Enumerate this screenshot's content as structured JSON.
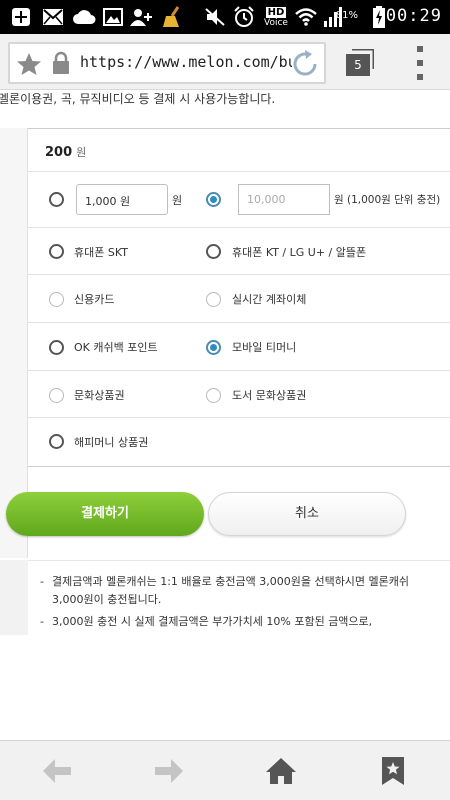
{
  "status_bar": {
    "time": "00:29",
    "battery_percent": "81%",
    "network_label_hd": "HD",
    "network_label_voice": "Voice",
    "icons": [
      "plus-icon",
      "mail-icon",
      "cloud-icon",
      "image-icon",
      "add-user-icon",
      "broom-icon",
      "mute-icon",
      "alarm-icon",
      "hd-voice-icon",
      "wifi-icon",
      "signal-icon",
      "battery-charging-icon"
    ]
  },
  "browser": {
    "url": "https://www.melon.com/buy/",
    "tab_count": "5",
    "icons": [
      "bookmark-star-icon",
      "lock-icon",
      "reload-icon",
      "tabs-icon",
      "menu-icon"
    ]
  },
  "page": {
    "top_note": "멜론이용권, 곡, 뮤직비디오 등 결제 시 사용가능합니다.",
    "amount": {
      "value": "200",
      "unit": "원"
    },
    "charge": {
      "custom_value": "1,000 원",
      "custom_unit": "원",
      "preset_placeholder": "10,000",
      "preset_suffix": "원 (1,000원 단위 충전)"
    },
    "methods": [
      {
        "label": "휴대폰 SKT",
        "state": "enabled"
      },
      {
        "label": "휴대폰 KT / LG U+ / 알뜰폰",
        "state": "enabled"
      },
      {
        "label": "신용카드",
        "state": "disabled"
      },
      {
        "label": "실시간 계좌이체",
        "state": "disabled"
      },
      {
        "label": "OK 캐쉬백 포인트",
        "state": "enabled"
      },
      {
        "label": "모바일 티머니",
        "state": "checked"
      },
      {
        "label": "문화상품권",
        "state": "disabled"
      },
      {
        "label": "도서 문화상품권",
        "state": "disabled"
      },
      {
        "label": "해피머니 상품권",
        "state": "enabled"
      }
    ],
    "buttons": {
      "pay": "결제하기",
      "cancel": "취소"
    },
    "notes": [
      "결제금액과 멜론캐쉬는 1:1 배율로 충전금액 3,000원을 선택하시면 멜론캐쉬 3,000원이 충전됩니다.",
      "3,000원 충전 시 실제 결제금액은 부가가치세 10% 포함된 금액으로,"
    ],
    "bullet": "-"
  },
  "bottom_nav": {
    "icons": [
      "back-arrow-icon",
      "forward-arrow-icon",
      "home-icon",
      "bookmarks-icon"
    ]
  },
  "colors": {
    "pay_button": "#6cb526",
    "radio_checked": "#2b8ec2"
  }
}
